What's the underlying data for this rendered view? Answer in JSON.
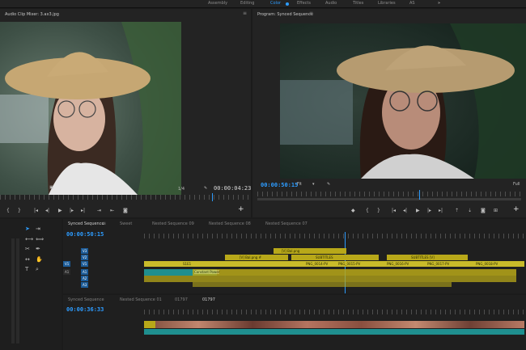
{
  "workspaces": [
    {
      "label": "Assembly",
      "active": false
    },
    {
      "label": "Editing",
      "active": false
    },
    {
      "label": "Color",
      "active": true
    },
    {
      "label": "Effects",
      "active": false
    },
    {
      "label": "Audio",
      "active": false
    },
    {
      "label": "Titles",
      "active": false
    },
    {
      "label": "Libraries",
      "active": false
    },
    {
      "label": "AS",
      "active": false
    }
  ],
  "more_workspaces": "»",
  "source_monitor": {
    "title": "Audio Clip Mixer: 3.ax3.jpg",
    "scale": "1/4",
    "timecode": "00:00:04:23"
  },
  "program_monitor": {
    "title": "Program: Synced Sequence",
    "timecode": "00:00:50:15",
    "fit": "Fit",
    "quality": "Full"
  },
  "timeline_top": {
    "tabs": [
      "Synced Sequence",
      "Sweet",
      "Nested Sequence 09",
      "Nested Sequence 08",
      "Nested Sequence 07"
    ],
    "active_tab": 0,
    "timecode": "00:00:50:15",
    "tracks": [
      {
        "id": "V3",
        "source": ""
      },
      {
        "id": "V2",
        "source": ""
      },
      {
        "id": "V1",
        "source": "V1"
      },
      {
        "id": "A1",
        "source": "A1"
      },
      {
        "id": "A2",
        "source": ""
      },
      {
        "id": "A3",
        "source": ""
      }
    ],
    "clips": [
      {
        "label": "[V] Bal.png",
        "track": 0
      },
      {
        "label": "[V] Bal.png #",
        "track": 1
      },
      {
        "label": "SUBTITLES",
        "track": 1
      },
      {
        "label": "SUBTITLES [V]",
        "track": 1
      },
      {
        "label": "S1E1",
        "track": 2
      },
      {
        "label": "PNG_0014-PV",
        "track": 2
      },
      {
        "label": "PNG_0015-PV",
        "track": 2
      },
      {
        "label": "PNG_0016-PV",
        "track": 2
      },
      {
        "label": "PNG_0017-PV",
        "track": 2
      },
      {
        "label": "PNG_0018-PV",
        "track": 2
      },
      {
        "label": "Constant Power",
        "track": 3
      }
    ]
  },
  "timeline_bottom": {
    "tabs": [
      "Synced Sequence",
      "Nested Sequence 01",
      "01797",
      "01797"
    ],
    "active_tab": 3,
    "timecode": "00:00:36:33"
  },
  "colors": {
    "accent": "#2d9cff",
    "clip_yellow": "#b8a819",
    "clip_teal": "#1f8f8f",
    "track_blue": "#1c5c99"
  }
}
